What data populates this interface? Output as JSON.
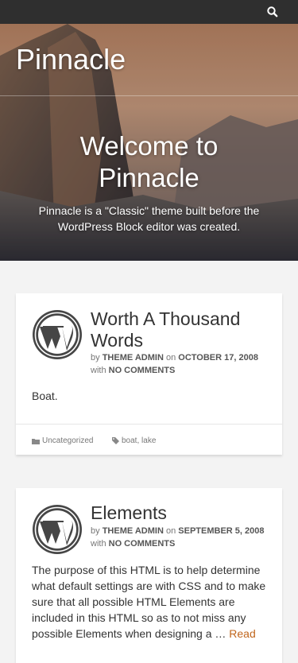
{
  "header": {
    "search_icon": "search-icon"
  },
  "site": {
    "title": "Pinnacle"
  },
  "hero": {
    "heading": "Welcome to Pinnacle",
    "text": "Pinnacle is a \"Classic\" theme built before the WordPress Block editor was created."
  },
  "posts": [
    {
      "title": "Worth A Thousand Words",
      "by": "by",
      "author": "THEME ADMIN",
      "on": "on",
      "date": "OCTOBER 17, 2008",
      "with": "with",
      "comments": "NO COMMENTS",
      "excerpt": "Boat.",
      "category": "Uncategorized",
      "tag1": "boat",
      "tag_sep": ", ",
      "tag2": "lake"
    },
    {
      "title": "Elements",
      "by": "by",
      "author": "THEME ADMIN",
      "on": "on",
      "date": "SEPTEMBER 5, 2008",
      "with": "with",
      "comments": "NO COMMENTS",
      "excerpt": "The purpose of this HTML is to help determine what default settings are with CSS and to make sure that all possible HTML Elements are included in this HTML so as to not miss any possible Elements when designing a … ",
      "read_more": "Read"
    }
  ],
  "colors": {
    "topbar": "#2f2f2f",
    "accent": "#c0651c",
    "background": "#f3f3f3"
  }
}
